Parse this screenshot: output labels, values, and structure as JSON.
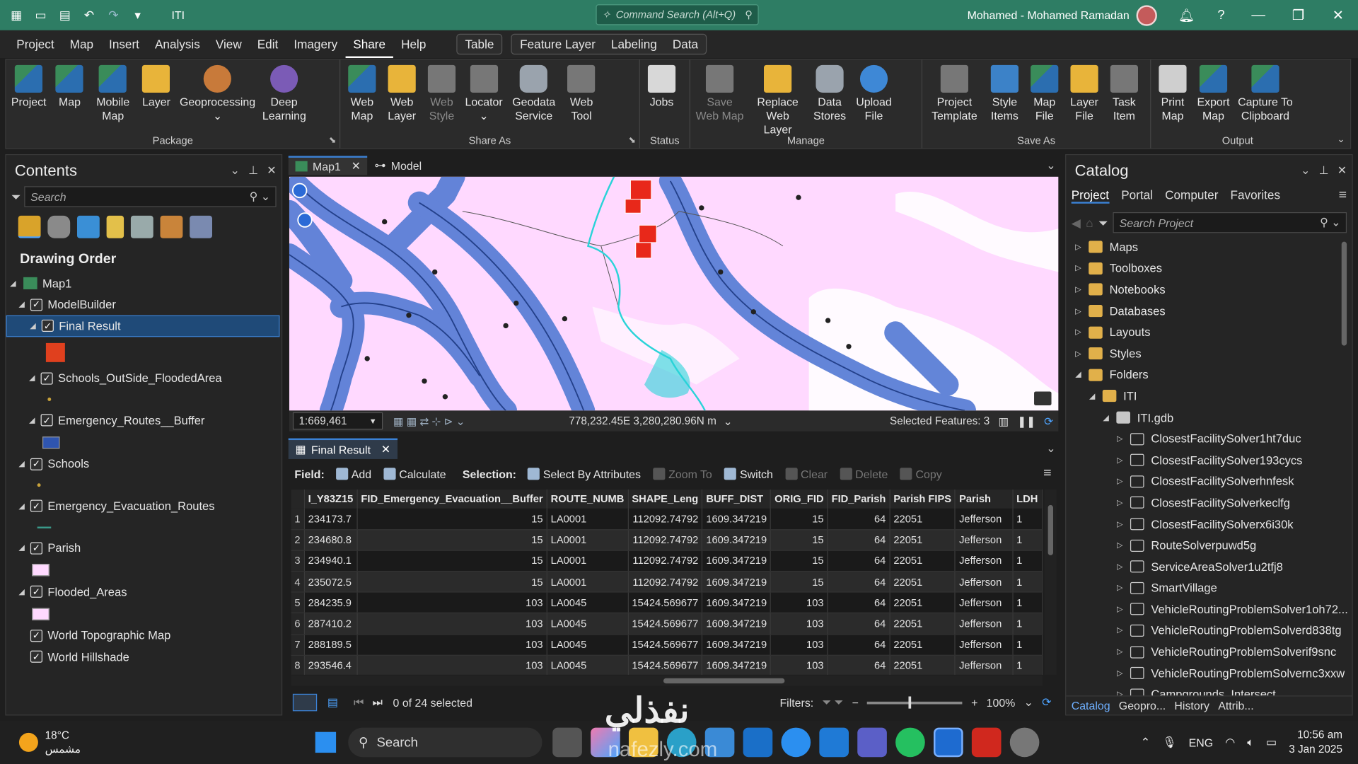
{
  "titlebar": {
    "project_name": "ITI",
    "command_search": "Command Search (Alt+Q)",
    "user": "Mohamed - Mohamed Ramadan",
    "help": "?"
  },
  "menu": {
    "tabs": [
      "Project",
      "Map",
      "Insert",
      "Analysis",
      "View",
      "Edit",
      "Imagery",
      "Share",
      "Help"
    ],
    "active": "Share",
    "context_table": "Table",
    "context_group": [
      "Feature Layer",
      "Labeling",
      "Data"
    ]
  },
  "ribbon": {
    "package": {
      "label": "Package",
      "buttons": [
        "Project",
        "Map",
        "Mobile Map",
        "Layer",
        "Geoprocessing",
        "Deep Learning"
      ]
    },
    "share_as": {
      "label": "Share As",
      "buttons": [
        "Web Map",
        "Web Layer",
        "Web Style",
        "Locator",
        "Geodata Service",
        "Web Tool"
      ]
    },
    "status": {
      "label": "Status",
      "buttons": [
        "Jobs"
      ]
    },
    "manage": {
      "label": "Manage",
      "buttons": [
        "Save Web Map",
        "Replace Web Layer",
        "Data Stores",
        "Upload File"
      ]
    },
    "save_as": {
      "label": "Save As",
      "buttons": [
        "Project Template",
        "Style Items",
        "Map File",
        "Layer File",
        "Task Item"
      ]
    },
    "output": {
      "label": "Output",
      "buttons": [
        "Print Map",
        "Export Map",
        "Capture To Clipboard"
      ]
    }
  },
  "contents": {
    "title": "Contents",
    "search_placeholder": "Search",
    "drawing_order": "Drawing Order",
    "map": "Map1",
    "layers": {
      "modelbuilder": "ModelBuilder",
      "final_result": "Final Result",
      "schools_outside": "Schools_OutSide_FloodedArea",
      "emergency_buffer": "Emergency_Routes__Buffer",
      "schools": "Schools",
      "evac_routes": "Emergency_Evacuation_Routes",
      "parish": "Parish",
      "flooded": "Flooded_Areas",
      "topo": "World Topographic Map",
      "hillshade": "World Hillshade"
    },
    "colors": {
      "buffer": "#2f55b0",
      "parish": "#ffd9ff",
      "flooded": "#ffd9ff"
    }
  },
  "map": {
    "tabs": [
      "Map1",
      "Model"
    ],
    "scale": "1:669,461",
    "coordinates": "778,232.45E 3,280,280.96N m",
    "selected": "Selected Features: 3",
    "colors": {
      "background": "#ffd9ff",
      "buffer": "#5b7fd6",
      "route": "#23408a",
      "water": "#ffffff",
      "flood": "#2ad3d8",
      "selection": "#e8281a"
    }
  },
  "table": {
    "tab": "Final Result",
    "field_label": "Field:",
    "field_buttons": [
      "Add",
      "Calculate"
    ],
    "selection_label": "Selection:",
    "selection_buttons": [
      "Select By Attributes",
      "Zoom To",
      "Switch",
      "Clear",
      "Delete",
      "Copy"
    ],
    "columns": [
      "I_Y83Z15",
      "FID_Emergency_Evacuation__Buffer",
      "ROUTE_NUMB",
      "SHAPE_Leng",
      "BUFF_DIST",
      "ORIG_FID",
      "FID_Parish",
      "Parish FIPS",
      "Parish",
      "LDH"
    ],
    "rows": [
      [
        "1",
        "234173.7",
        "15",
        "LA0001",
        "112092.74792",
        "1609.347219",
        "15",
        "64",
        "22051",
        "Jefferson",
        "1"
      ],
      [
        "2",
        "234680.8",
        "15",
        "LA0001",
        "112092.74792",
        "1609.347219",
        "15",
        "64",
        "22051",
        "Jefferson",
        "1"
      ],
      [
        "3",
        "234940.1",
        "15",
        "LA0001",
        "112092.74792",
        "1609.347219",
        "15",
        "64",
        "22051",
        "Jefferson",
        "1"
      ],
      [
        "4",
        "235072.5",
        "15",
        "LA0001",
        "112092.74792",
        "1609.347219",
        "15",
        "64",
        "22051",
        "Jefferson",
        "1"
      ],
      [
        "5",
        "284235.9",
        "103",
        "LA0045",
        "15424.569677",
        "1609.347219",
        "103",
        "64",
        "22051",
        "Jefferson",
        "1"
      ],
      [
        "6",
        "287410.2",
        "103",
        "LA0045",
        "15424.569677",
        "1609.347219",
        "103",
        "64",
        "22051",
        "Jefferson",
        "1"
      ],
      [
        "7",
        "288189.5",
        "103",
        "LA0045",
        "15424.569677",
        "1609.347219",
        "103",
        "64",
        "22051",
        "Jefferson",
        "1"
      ],
      [
        "8",
        "293546.4",
        "103",
        "LA0045",
        "15424.569677",
        "1609.347219",
        "103",
        "64",
        "22051",
        "Jefferson",
        "1"
      ]
    ],
    "selected_text": "0 of 24 selected",
    "filters_label": "Filters:",
    "zoom": "100%"
  },
  "catalog": {
    "title": "Catalog",
    "tabs": [
      "Project",
      "Portal",
      "Computer",
      "Favorites"
    ],
    "search_placeholder": "Search Project",
    "items": [
      "Maps",
      "Toolboxes",
      "Notebooks",
      "Databases",
      "Layouts",
      "Styles",
      "Folders"
    ],
    "folder": "ITI",
    "gdb": "ITI.gdb",
    "datasets": [
      "ClosestFacilitySolver1ht7duc",
      "ClosestFacilitySolver193cycs",
      "ClosestFacilitySolverhnfesk",
      "ClosestFacilitySolverkeclfg",
      "ClosestFacilitySolverx6i30k",
      "RouteSolverpuwd5g",
      "ServiceAreaSolver1u2tfj8",
      "SmartVillage",
      "VehicleRoutingProblemSolver1oh72...",
      "VehicleRoutingProblemSolverd838tg",
      "VehicleRoutingProblemSolverif9snc",
      "VehicleRoutingProblemSolvernc3xxw",
      "Campgrounds_Intersect"
    ],
    "bottom_tabs": [
      "Catalog",
      "Geopro...",
      "History",
      "Attrib..."
    ]
  },
  "taskbar": {
    "temp": "18°C",
    "weather": "مشمس",
    "search": "Search",
    "lang": "ENG",
    "time": "10:56 am",
    "date": "3 Jan 2025"
  },
  "watermark": {
    "text": "نفذلي",
    "url": "nafezly.com"
  }
}
